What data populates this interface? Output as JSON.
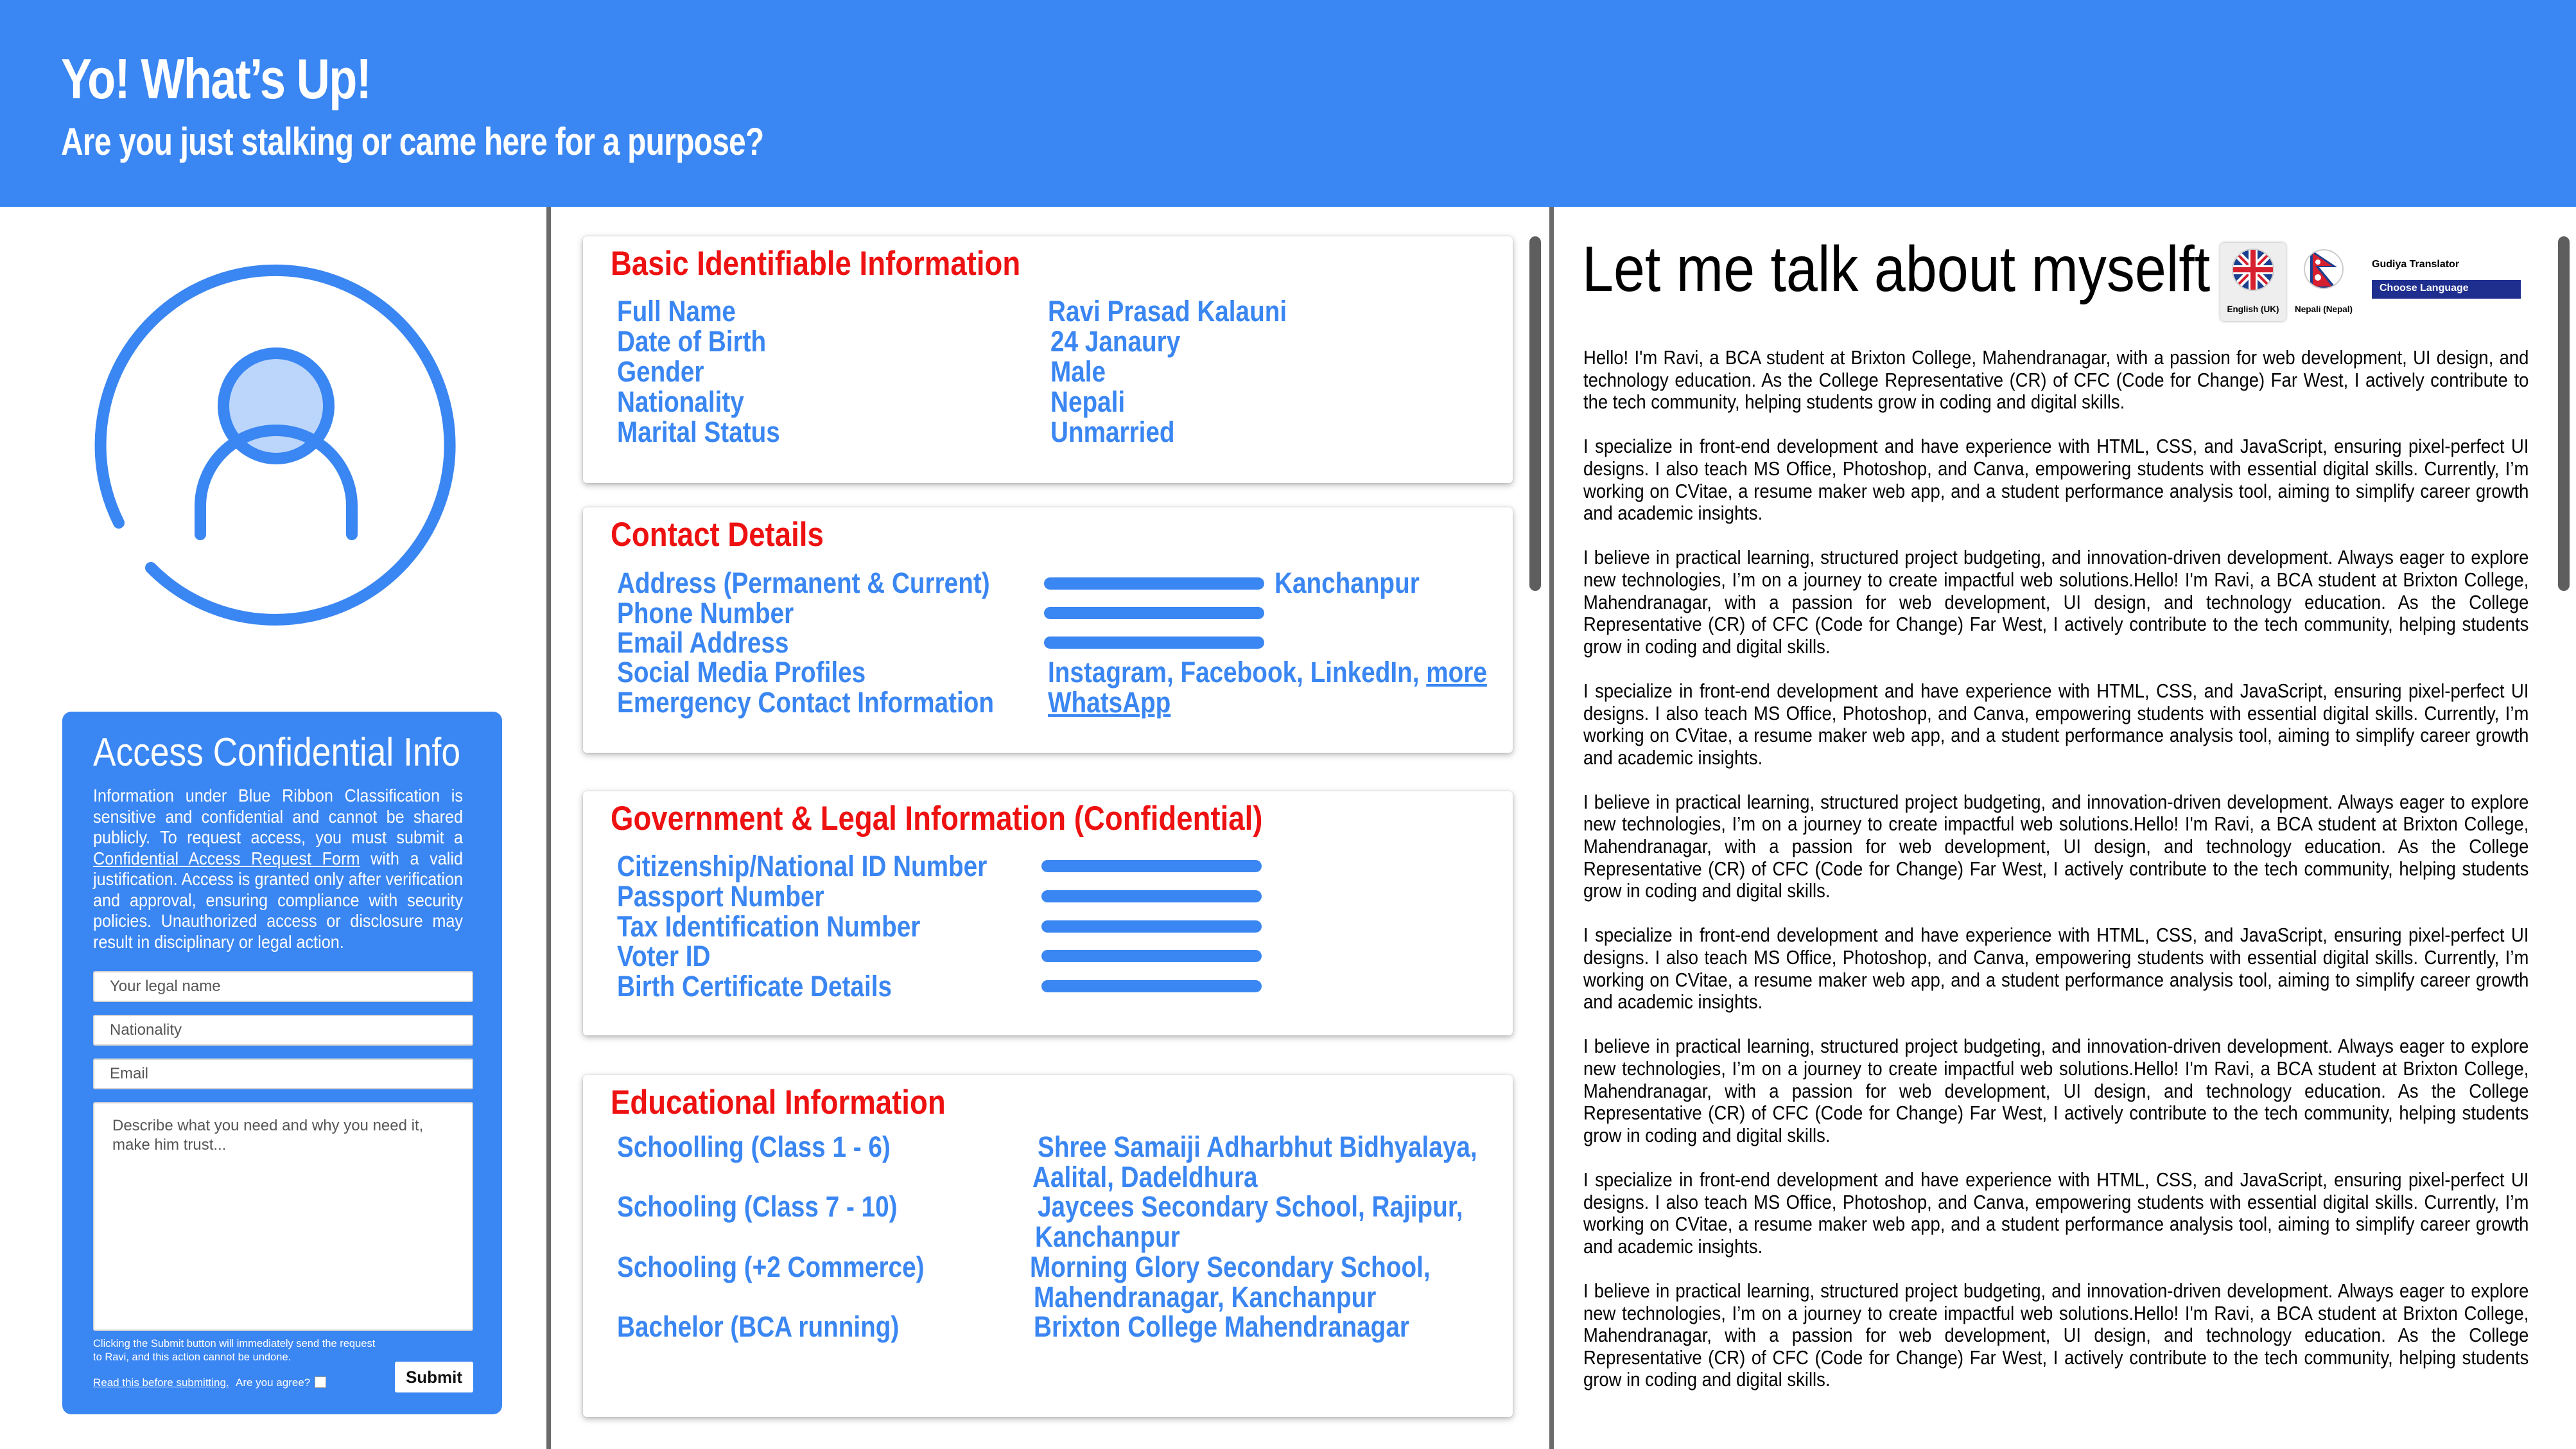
{
  "header": {
    "title": "Yo! What’s Up!",
    "subtitle": "Are you just stalking or came here for a purpose?"
  },
  "access": {
    "title": "Access Confidential Info",
    "desc_before": "Information under Blue Ribbon Classification is sensitive and confidential and cannot be shared publicly. To request access, you must submit a ",
    "desc_link": "Confidential Access Request Form",
    "desc_after": " with a valid justification. Access is granted only after verification and approval, ensuring compliance with security policies. Unauthorized access or disclosure may result in disciplinary or legal action.",
    "name_placeholder": "Your legal name",
    "nationality_placeholder": "Nationality",
    "email_placeholder": "Email",
    "message_placeholder": "Describe what you need and why you need it, make him trust...",
    "note": "Clicking the Submit button will immediately send the request to Ravi, and this action cannot be undone.",
    "read_link": "Read this before submitting.",
    "agree_label": "Are you agree?",
    "submit_label": "Submit"
  },
  "basic": {
    "title": "Basic Identifiable Information",
    "rows": [
      {
        "label": "Full Name",
        "value": "Ravi Prasad Kalauni"
      },
      {
        "label": "Date of Birth",
        "value": "24 Janaury"
      },
      {
        "label": "Gender",
        "value": "Male"
      },
      {
        "label": "Nationality",
        "value": "Nepali"
      },
      {
        "label": "Marital Status",
        "value": "Unmarried"
      }
    ]
  },
  "contact": {
    "title": "Contact Details",
    "rows": [
      {
        "label": "Address (Permanent & Current)",
        "value": "Kanchanpur"
      },
      {
        "label": "Phone Number",
        "value": ""
      },
      {
        "label": "Email Address",
        "value": ""
      },
      {
        "label": "Social Media Profiles",
        "value": "Instagram, Facebook, LinkedIn, "
      },
      {
        "label": "Emergency Contact Information",
        "value": ""
      }
    ],
    "more_link": "more",
    "whatsapp_link": "WhatsApp"
  },
  "government": {
    "title": "Government & Legal Information (Confidential)",
    "rows": [
      {
        "label": "Citizenship/National ID Number"
      },
      {
        "label": "Passport Number"
      },
      {
        "label": "Tax Identification Number"
      },
      {
        "label": "Voter ID"
      },
      {
        "label": "Birth Certificate Details"
      }
    ]
  },
  "education": {
    "title": "Educational Information",
    "rows": [
      {
        "label": "Schoolling (Class 1 - 6)",
        "line1": "Shree Samaiji Adharbhut Bidhyalaya,",
        "line2": "Aalital, Dadeldhura"
      },
      {
        "label": "Schooling (Class 7 - 10)",
        "line1": "Jaycees Secondary School, Rajipur,",
        "line2": "Kanchanpur"
      },
      {
        "label": "Schooling (+2 Commerce)",
        "line1": "Morning Glory Secondary School,",
        "line2": "Mahendranagar, Kanchanpur"
      },
      {
        "label": "Bachelor (BCA running)",
        "line1": "Brixton College Mahendranagar",
        "line2": ""
      }
    ]
  },
  "about": {
    "title": "Let me talk about myselft",
    "paragraphs": [
      "Hello! I'm Ravi, a BCA student at Brixton College, Mahendranagar, with a passion for web development, UI design, and technology education. As the College Representative (CR) of CFC (Code for Change) Far West, I actively contribute to the tech community, helping students grow in coding and digital skills.",
      "I specialize in front-end development and have experience with HTML, CSS, and JavaScript, ensuring pixel-perfect UI designs. I also teach MS Office, Photoshop, and Canva, empowering students with essential digital skills. Currently, I’m working on CVitae, a resume maker web app, and a student performance analysis tool, aiming to simplify career growth and academic insights.",
      "I believe in practical learning, structured project budgeting, and innovation-driven development. Always eager to explore new technologies, I’m on a journey to create impactful web solutions.Hello! I'm Ravi, a BCA student at Brixton College, Mahendranagar, with a passion for web development, UI design, and technology education. As the College Representative (CR) of CFC (Code for Change) Far West, I actively contribute to the tech community, helping students grow in coding and digital skills.",
      "I specialize in front-end development and have experience with HTML, CSS, and JavaScript, ensuring pixel-perfect UI designs. I also teach MS Office, Photoshop, and Canva, empowering students with essential digital skills. Currently, I’m working on CVitae, a resume maker web app, and a student performance analysis tool, aiming to simplify career growth and academic insights.",
      "I believe in practical learning, structured project budgeting, and innovation-driven development. Always eager to explore new technologies, I’m on a journey to create impactful web solutions.Hello! I'm Ravi, a BCA student at Brixton College, Mahendranagar, with a passion for web development, UI design, and technology education. As the College Representative (CR) of CFC (Code for Change) Far West, I actively contribute to the tech community, helping students grow in coding and digital skills.",
      "I specialize in front-end development and have experience with HTML, CSS, and JavaScript, ensuring pixel-perfect UI designs. I also teach MS Office, Photoshop, and Canva, empowering students with essential digital skills. Currently, I’m working on CVitae, a resume maker web app, and a student performance analysis tool, aiming to simplify career growth and academic insights.",
      "I believe in practical learning, structured project budgeting, and innovation-driven development. Always eager to explore new technologies, I’m on a journey to create impactful web solutions.Hello! I'm Ravi, a BCA student at Brixton College, Mahendranagar, with a passion for web development, UI design, and technology education. As the College Representative (CR) of CFC (Code for Change) Far West, I actively contribute to the tech community, helping students grow in coding and digital skills.",
      "I specialize in front-end development and have experience with HTML, CSS, and JavaScript, ensuring pixel-perfect UI designs. I also teach MS Office, Photoshop, and Canva, empowering students with essential digital skills. Currently, I’m working on CVitae, a resume maker web app, and a student performance analysis tool, aiming to simplify career growth and academic insights.",
      "I believe in practical learning, structured project budgeting, and innovation-driven development. Always eager to explore new technologies, I’m on a journey to create impactful web solutions.Hello! I'm Ravi, a BCA student at Brixton College, Mahendranagar, with a passion for web development, UI design, and technology education. As the College Representative (CR) of CFC (Code for Change) Far West, I actively contribute to the tech community, helping students grow in coding and digital skills."
    ]
  },
  "language": {
    "english_label": "English (UK)",
    "nepali_label": "Nepali (Nepal)",
    "translator_label": "Gudiya Translator",
    "choose_label": "Choose Language"
  },
  "icons": {
    "avatar": "user-avatar-icon",
    "uk_flag": "uk-flag-icon",
    "nepal_flag": "nepal-flag-icon"
  },
  "colors": {
    "accent": "#3a86f2",
    "heading_red": "#ee1111",
    "divider": "#6b6b6b",
    "translator_bar": "#1f2f8f"
  }
}
